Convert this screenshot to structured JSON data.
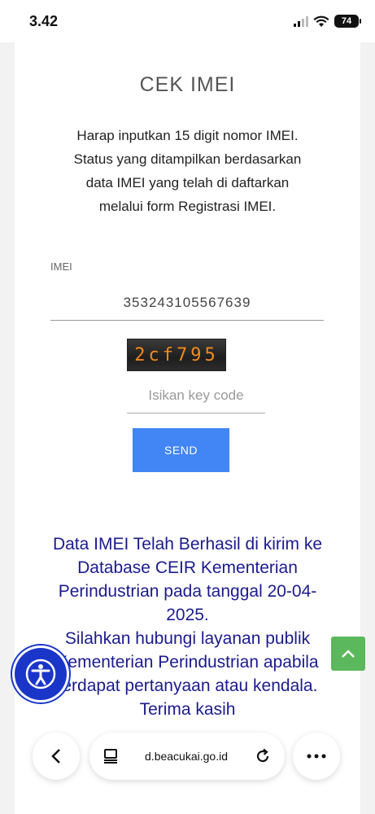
{
  "status_bar": {
    "time": "3.42",
    "battery": "74"
  },
  "form": {
    "title": "CEK IMEI",
    "instructions": [
      "Harap inputkan 15 digit nomor IMEI.",
      "Status yang ditampilkan berdasarkan",
      "data IMEI yang telah di daftarkan",
      "melalui form Registrasi IMEI."
    ],
    "imei_label": "IMEI",
    "imei_value": "353243105567639",
    "captcha_text": "2cf795",
    "key_code_placeholder": "Isikan key code",
    "send_label": "SEND"
  },
  "result": {
    "lines": [
      "Data IMEI Telah Berhasil di kirim ke",
      "Database CEIR Kementerian",
      "Perindustrian pada tanggal 20-04-",
      "2025.",
      "Silahkan hubungi layanan publik",
      "Kementerian Perindustrian apabila",
      "terdapat pertanyaan atau kendala.",
      "Terima kasih"
    ]
  },
  "browser": {
    "url": "d.beacukai.go.id"
  },
  "colors": {
    "send_button": "#4285f4",
    "result_text": "#1b1b8f",
    "scroll_top": "#5cb85c",
    "accessibility": "#1a36c9"
  },
  "icons": [
    "signal-icon",
    "wifi-icon",
    "battery-icon",
    "chevron-up-icon",
    "accessibility-icon",
    "back-icon",
    "page-icon",
    "reload-icon",
    "more-icon"
  ]
}
